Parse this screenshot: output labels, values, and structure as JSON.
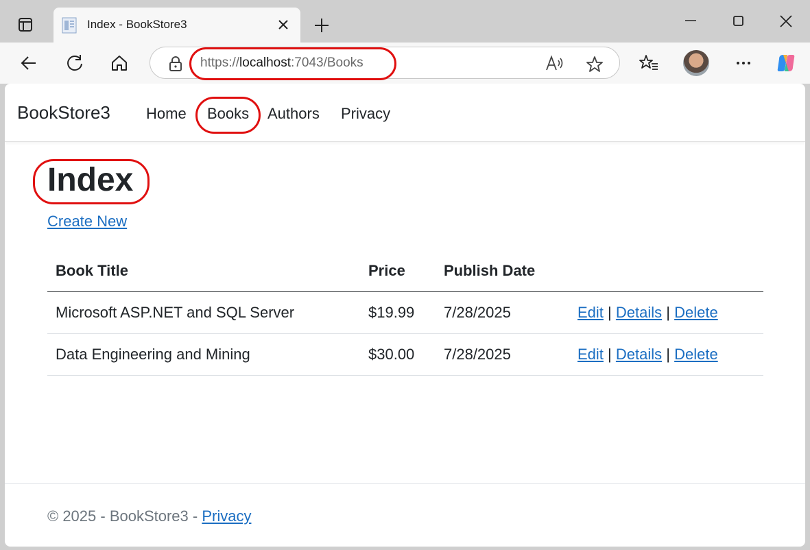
{
  "browser": {
    "tab_title": "Index - BookStore3",
    "url_scheme": "https://",
    "url_host": "localhost",
    "url_rest": ":7043/Books",
    "icons": [
      "tab-actions-icon",
      "page-favicon-icon",
      "close-icon",
      "plus-icon",
      "minimize-icon",
      "maximize-icon",
      "close-window-icon",
      "back-arrow-icon",
      "refresh-icon",
      "home-icon",
      "lock-icon",
      "read-aloud-icon",
      "star-icon",
      "favorites-icon",
      "more-icon",
      "copilot-icon"
    ]
  },
  "navbar": {
    "brand": "BookStore3",
    "links": [
      "Home",
      "Books",
      "Authors",
      "Privacy"
    ]
  },
  "main": {
    "title": "Index",
    "create_link": "Create New",
    "table": {
      "headers": [
        "Book Title",
        "Price",
        "Publish Date"
      ],
      "rows": [
        {
          "title": "Microsoft ASP.NET and SQL Server",
          "price": "$19.99",
          "date": "7/28/2025"
        },
        {
          "title": "Data Engineering and Mining",
          "price": "$30.00",
          "date": "7/28/2025"
        }
      ],
      "actions": {
        "edit": "Edit",
        "details": "Details",
        "delete": "Delete",
        "separator": "|"
      }
    }
  },
  "footer": {
    "text": "© 2025 - BookStore3 - ",
    "link": "Privacy"
  },
  "colors": {
    "link": "#1b6ec2",
    "annotation": "#e01010"
  }
}
